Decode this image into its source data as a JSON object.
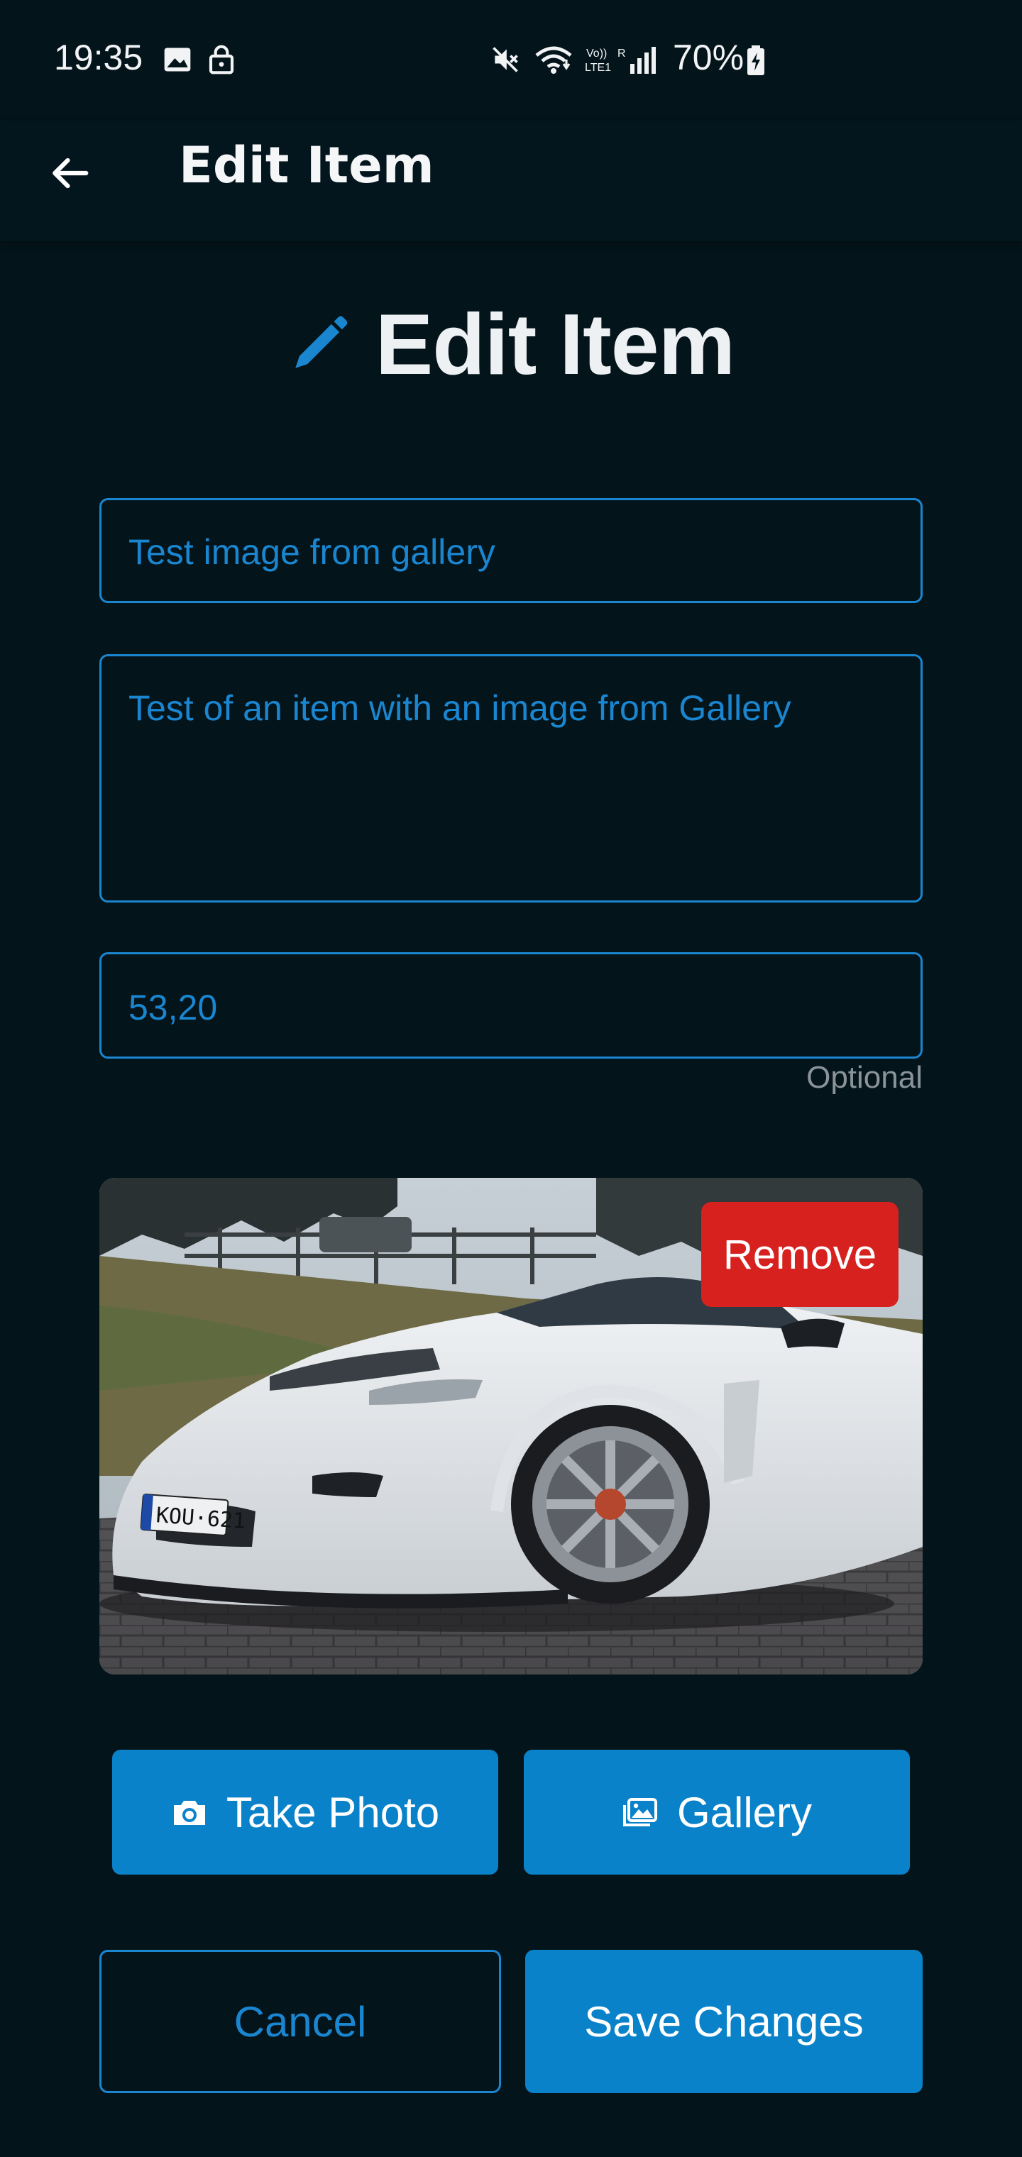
{
  "status_bar": {
    "time": "19:35",
    "battery": "70%",
    "icons": [
      "image-icon",
      "lock-icon",
      "mute-icon",
      "wifi-icon",
      "volte-icon",
      "signal-icon",
      "battery-charging-icon"
    ]
  },
  "app_bar": {
    "title": "Edit Item",
    "back_icon": "arrow-left-icon"
  },
  "heading": {
    "icon": "pencil-icon",
    "text": "Edit Item"
  },
  "form": {
    "name_value": "Test image from gallery",
    "description_value": "Test of an item with an image from Gallery",
    "price_value": "53,20",
    "price_helper": "Optional"
  },
  "image": {
    "remove_label": "Remove"
  },
  "photo_actions": {
    "take_photo_label": "Take Photo",
    "take_photo_icon": "camera-icon",
    "gallery_label": "Gallery",
    "gallery_icon": "gallery-icon"
  },
  "actions": {
    "cancel_label": "Cancel",
    "save_label": "Save Changes"
  },
  "colors": {
    "background": "#04141b",
    "accent": "#0a82c9",
    "danger": "#d6211f",
    "helper": "#8a939a"
  }
}
